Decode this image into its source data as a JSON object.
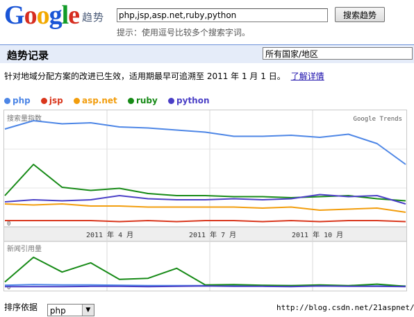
{
  "header": {
    "logo_letters": [
      "G",
      "o",
      "o",
      "g",
      "l",
      "e"
    ],
    "logo_suffix": "趋势",
    "search_value": "php,jsp,asp.net,ruby,python",
    "search_button": "搜索趋势",
    "hint": "提示：使用逗号比较多个搜索字词。"
  },
  "bar": {
    "title": "趋势记录",
    "region_selected": "所有国家/地区"
  },
  "notice": {
    "text": "针对地域分配方案的改进已生效，适用期最早可追溯至 2011 年 1 月 1 日。",
    "link": "了解详情"
  },
  "legend": [
    {
      "name": "php",
      "color": "#4d86e6"
    },
    {
      "name": "jsp",
      "color": "#d9361c"
    },
    {
      "name": "asp.net",
      "color": "#f29d0c"
    },
    {
      "name": "ruby",
      "color": "#168a16"
    },
    {
      "name": "python",
      "color": "#4a3fc6"
    }
  ],
  "chart_data": [
    {
      "type": "line",
      "title": "搜索量指数",
      "watermark": "Google Trends",
      "zero_label": "0",
      "x_tick_labels": [
        "2011 年 4 月",
        "2011 年 7 月",
        "2011 年 10 月"
      ],
      "x": [
        "2011-01",
        "2011-02",
        "2011-03",
        "2011-04",
        "2011-05",
        "2011-06",
        "2011-07",
        "2011-08",
        "2011-09",
        "2011-10",
        "2011-11",
        "2011-12"
      ],
      "ylim": [
        0,
        100
      ],
      "series": [
        {
          "name": "php",
          "color": "#4d86e6",
          "values": [
            92,
            100,
            97,
            98,
            94,
            93,
            91,
            89,
            85,
            85,
            86,
            84,
            87,
            78,
            58
          ]
        },
        {
          "name": "jsp",
          "color": "#d9361c",
          "values": [
            4,
            4,
            4,
            4,
            3,
            4,
            3,
            4,
            4,
            3,
            4,
            3,
            4,
            4,
            3
          ]
        },
        {
          "name": "asp.net",
          "color": "#f29d0c",
          "values": [
            20,
            19,
            20,
            18,
            18,
            17,
            17,
            17,
            17,
            16,
            17,
            14,
            15,
            16,
            12
          ]
        },
        {
          "name": "ruby",
          "color": "#168a16",
          "values": [
            28,
            58,
            36,
            33,
            35,
            30,
            28,
            28,
            27,
            27,
            26,
            27,
            28,
            25,
            23
          ]
        },
        {
          "name": "python",
          "color": "#4a3fc6",
          "values": [
            22,
            24,
            23,
            24,
            28,
            25,
            24,
            24,
            25,
            24,
            25,
            29,
            27,
            28,
            20
          ]
        }
      ]
    },
    {
      "type": "line",
      "title": "新闻引用量",
      "zero_label": "0",
      "series": [
        {
          "name": "php",
          "color": "#4d86e6",
          "values": [
            9,
            11,
            10,
            10,
            9,
            8,
            8,
            8,
            8,
            8,
            8,
            7,
            7,
            7,
            7
          ]
        },
        {
          "name": "ruby",
          "color": "#168a16",
          "values": [
            18,
            85,
            45,
            70,
            25,
            28,
            55,
            10,
            11,
            9,
            8,
            10,
            8,
            12,
            6
          ]
        },
        {
          "name": "python",
          "color": "#4a3fc6",
          "values": [
            5,
            5,
            5,
            6,
            6,
            5,
            6,
            7,
            6,
            6,
            5,
            7,
            6,
            6,
            5
          ]
        }
      ]
    }
  ],
  "sort": {
    "label": "排序依据",
    "selected": "php"
  },
  "url_text": "http://blog.csdn.net/21aspnet/"
}
